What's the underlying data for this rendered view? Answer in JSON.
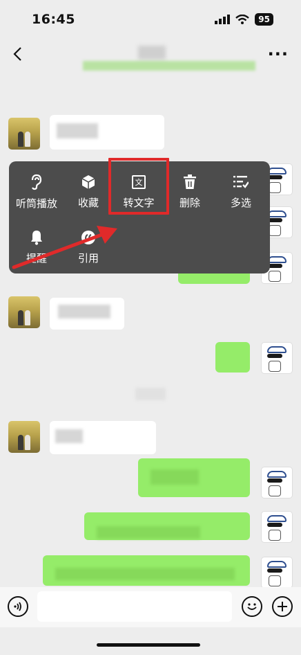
{
  "status_bar": {
    "time": "16:45",
    "battery": "95"
  },
  "menu": {
    "items": [
      {
        "label": "听筒播放",
        "icon": "ear-icon"
      },
      {
        "label": "收藏",
        "icon": "cube-icon"
      },
      {
        "label": "转文字",
        "icon": "text-convert-icon"
      },
      {
        "label": "删除",
        "icon": "trash-icon"
      },
      {
        "label": "多选",
        "icon": "multi-select-icon"
      },
      {
        "label": "提醒",
        "icon": "bell-icon"
      },
      {
        "label": "引用",
        "icon": "quote-icon"
      }
    ],
    "convert_icon_glyph": "文"
  },
  "colors": {
    "menu_bg": "#4c4c4c",
    "highlight": "#e02a2a",
    "bubble_green": "#95ec69",
    "chat_bg": "#ededed"
  }
}
